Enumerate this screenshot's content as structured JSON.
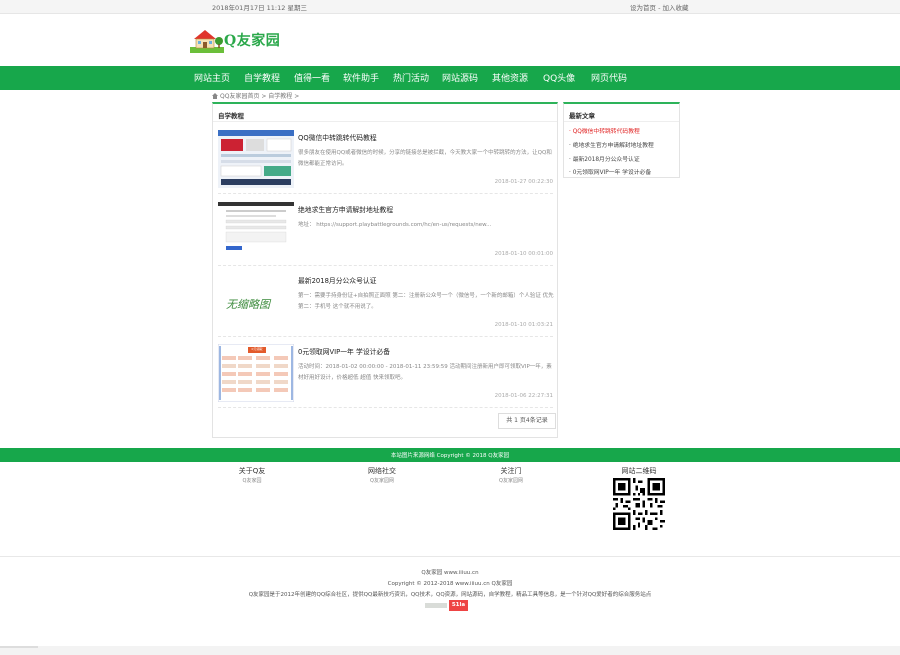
{
  "topbar": {
    "date": "2018年01月17日 11:12 星期三",
    "set_home": "设为首页",
    "sep": " - ",
    "add_fav": "加入收藏"
  },
  "logo": {
    "text": "Q友家园",
    "alt": "QYJ"
  },
  "nav": {
    "items": [
      "网站主页",
      "自学教程",
      "值得一看",
      "软件助手",
      "热门活动",
      "网站源码",
      "其他资源",
      "QQ头像",
      "网页代码"
    ]
  },
  "breadcrumb": {
    "home": "QQ友家园首页",
    "sep": " > ",
    "current": "自学教程",
    "tail": " >"
  },
  "main": {
    "heading": "自学教程",
    "articles": [
      {
        "title": "QQ微信中转跳转代码教程",
        "desc": "很多朋友在使用QQ或者微信的时候，分享的链接总是被拦截，今天教大家一个中转跳转的方法，让QQ和微信都能正常访问。",
        "time": "2018-01-27 00:22:30",
        "thumb": "screenshot"
      },
      {
        "title": "绝地求生官方申请解封地址教程",
        "desc": "地址： https://support.playbattlegrounds.com/hc/en-us/requests/new...",
        "time": "2018-01-10 00:01:00",
        "thumb": "document"
      },
      {
        "title": "最新2018月分公众号认证",
        "desc": "第一：需要手持身份证+自拍照正面照 第二：注册新公众号一个（微信号，一个新的邮箱）个人验证 优先 第二：手机号 这个就不用说了。",
        "time": "2018-01-10 01:03:21",
        "thumb": "none",
        "no_thumb_text": "无缩略图"
      },
      {
        "title": "0元领取网VIP一年 学设计必备",
        "desc": "活动时间：2018-01-02 00:00:00 - 2018-01-11 23:59:59 活动期间注册新用户即可领取VIP一年，素材好用好设计，价格超低 超值 快来领取吧。",
        "time": "2018-01-06 22:27:31",
        "thumb": "promo",
        "promo_label": "0元领取"
      }
    ],
    "pager": "共 1 页4条记录"
  },
  "sidebar": {
    "heading": "最新文章",
    "items": [
      "QQ微信中转跳转代码教程",
      "绝地求生官方申请解封地址教程",
      "最新2018月分公众号认证",
      "0元领取网VIP一年 学设计必备"
    ]
  },
  "footer": {
    "band": "本站图片来源网络 Copyright © 2018 Q友家园",
    "cols": [
      {
        "title": "关于Q友",
        "sub": "Q友家园"
      },
      {
        "title": "网络社交",
        "sub": "Q友家园网"
      },
      {
        "title": "关注门",
        "sub": "Q友家园网"
      },
      {
        "title": "网站二维码",
        "sub": ""
      }
    ],
    "line1": "Q友家园 www.iiiuu.cn",
    "line2": "Copyright © 2012-2018 www.iiiuu.cn Q友家园",
    "line3": "Q友家园是于2012年创建的QQ综合社区，提供QQ最新技巧资讯，QQ技术，QQ资源，网站源码，自学教程，精品工具等信息，是一个针对QQ爱好者的综合服务站点",
    "badge": "51la"
  },
  "colors": {
    "green": "#17a74b",
    "accent_red": "#e02020"
  }
}
